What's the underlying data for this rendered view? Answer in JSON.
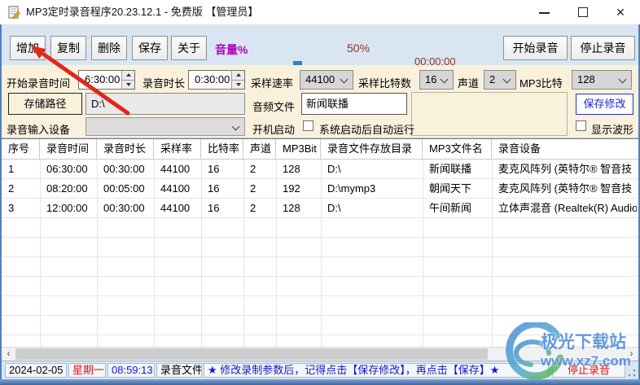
{
  "window": {
    "title": "MP3定时录音程序20.23.12.1 - 免费版 【管理员】"
  },
  "icons": {
    "app-icon": "notepad-with-pencil",
    "minimize-icon": "–",
    "maximize-icon": "□",
    "close-icon": "✕",
    "combo-chevron-icon": "∨",
    "spinner-up-icon": "▲",
    "spinner-down-icon": "▼",
    "scroll-left-icon": "‹",
    "scroll-right-icon": "›"
  },
  "toolbar": {
    "buttons": [
      "增加",
      "复制",
      "删除",
      "保存",
      "关于"
    ],
    "volume_label": "音量%",
    "volume_value": "50%",
    "elapsed_time": "00:00:00",
    "start_button": "开始录音",
    "stop_button": "停止录音"
  },
  "settings": {
    "start_time_label": "开始录音时间",
    "start_time_value": "6:30:00",
    "duration_label": "录音时长",
    "duration_value": "0:30:00",
    "sample_rate_label": "采样速率",
    "sample_rate_value": "44100",
    "sample_bits_label": "采样比特数",
    "sample_bits_value": "16",
    "channels_label": "声道",
    "channels_value": "2",
    "mp3_bitrate_label": "MP3比特",
    "mp3_bitrate_value": "128",
    "storage_path_button": "存储路径",
    "storage_path_value": "D:\\",
    "audio_file_label": "音频文件",
    "audio_file_value": "新闻联播",
    "input_device_label": "录音输入设备",
    "input_device_value": "",
    "autostart_label": "开机启动",
    "autostart_checkbox_label": "系统启动后自动运行",
    "save_changes_button": "保存修改",
    "show_waveform_label": "显示波形"
  },
  "table": {
    "columns": [
      "序号",
      "录音时间",
      "录音时长",
      "采样率",
      "比特率",
      "声道",
      "MP3Bit",
      "录音文件存放目录",
      "MP3文件名",
      "录音设备"
    ],
    "rows": [
      [
        "1",
        "06:30:00",
        "00:30:00",
        "44100",
        "16",
        "2",
        "128",
        "D:\\",
        "新闻联播",
        "麦克风阵列 (英特尔® 智音技"
      ],
      [
        "2",
        "08:20:00",
        "00:05:00",
        "44100",
        "16",
        "2",
        "192",
        "D:\\mymp3",
        "朝闻天下",
        "麦克风阵列 (英特尔® 智音技"
      ],
      [
        "3",
        "12:00:00",
        "00:30:00",
        "44100",
        "16",
        "2",
        "128",
        "D:\\",
        "午间新闻",
        "立体声混音 (Realtek(R) Audio"
      ]
    ]
  },
  "statusbar": {
    "date": "2024-02-05",
    "weekday": "星期一",
    "time": "08:59:13",
    "mode": "录音文件",
    "hint": "★ 修改录制参数后，记得点击【保存修改】，再点击【保存】★",
    "state": "停止录音"
  },
  "watermark": {
    "site_name": "极光下载站",
    "url": "www.xz7.com"
  },
  "colors": {
    "window_bg": "#d9e6f2",
    "panel_bg": "#faf1dc",
    "progress_green": "#24b14c",
    "volume_label_magenta": "#b000c0",
    "percent_dark_red": "#8b3333",
    "timer_dark_red": "#8b2f2f",
    "status_time_blue": "#1515cc",
    "hint_blue": "#1515cc",
    "weekday_red": "#e01010",
    "state_red": "#e01010",
    "arrow_red": "#e02818",
    "save_changes_blue": "#2222cc",
    "slider_thumb_blue": "#2e80d8",
    "watermark_blue": "#4285d6"
  }
}
